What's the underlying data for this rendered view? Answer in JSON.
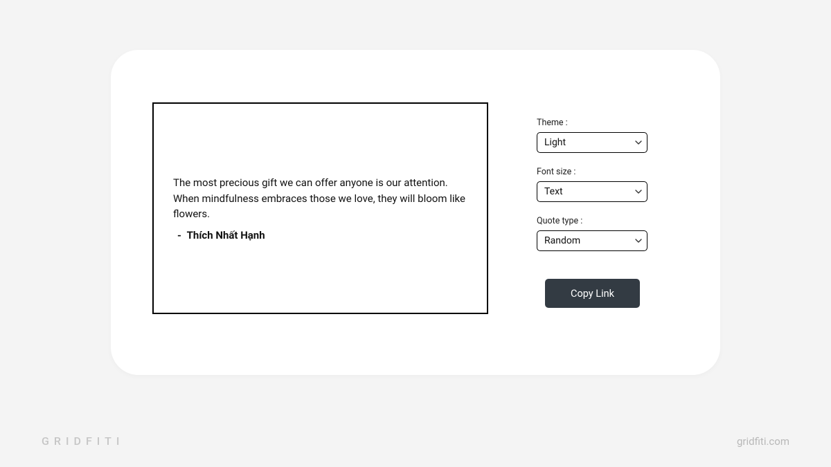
{
  "preview": {
    "quote_text": "The most precious gift we can offer anyone is our attention. When mindfulness embraces those we love, they will bloom like flowers.",
    "attribution_dash": "- ",
    "author": "Thích Nhất Hạnh"
  },
  "controls": {
    "theme": {
      "label": "Theme :",
      "value": "Light"
    },
    "font_size": {
      "label": "Font size :",
      "value": "Text"
    },
    "quote_type": {
      "label": "Quote type :",
      "value": "Random"
    }
  },
  "actions": {
    "copy_link_label": "Copy Link"
  },
  "footer": {
    "brand": "GRIDFITI",
    "site": "gridfiti.com"
  }
}
